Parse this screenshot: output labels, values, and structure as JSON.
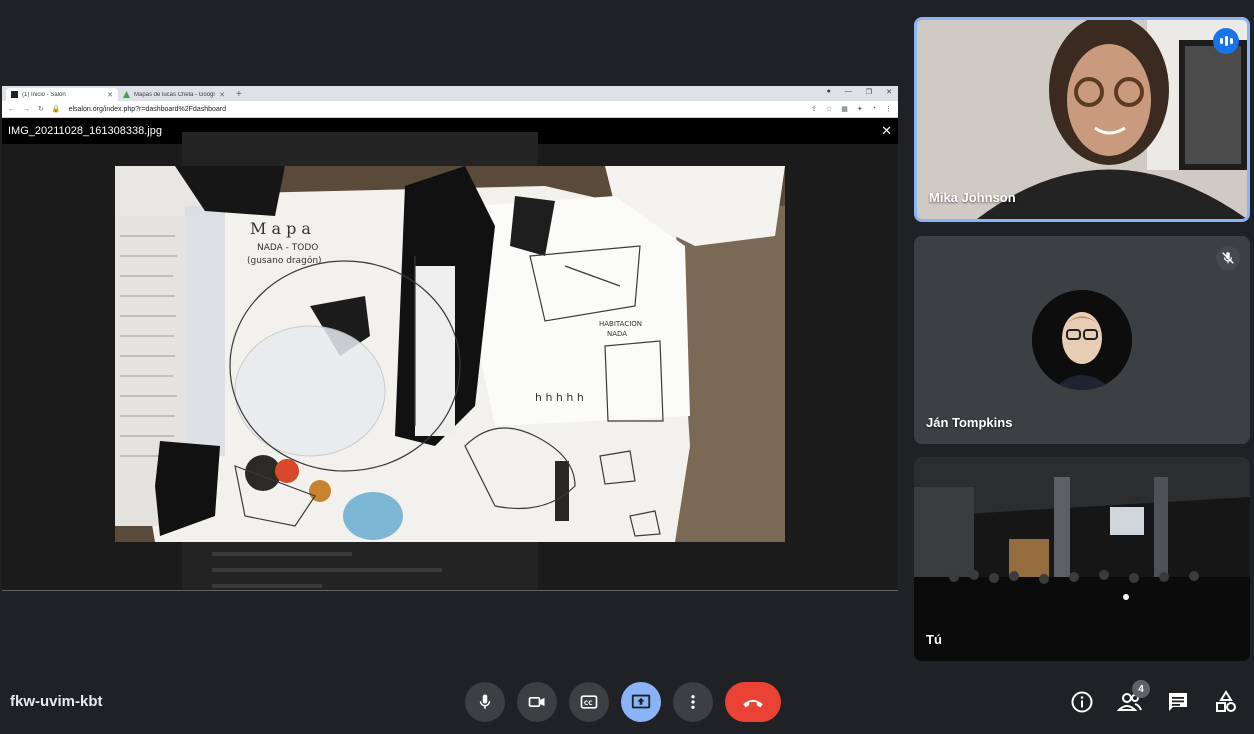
{
  "meeting": {
    "code": "fkw-uvim-kbt"
  },
  "browser": {
    "tabs": [
      {
        "label": "(1) Inicio - Salón"
      },
      {
        "label": "Mapas de lucas Chela - Google D"
      }
    ],
    "url": "elsalon.org/index.php?r=dashboard%2Fdashboard"
  },
  "viewer": {
    "filename": "IMG_20211028_161308338.jpg"
  },
  "drawing_text": {
    "line1": "M a p a",
    "line2": "NADA - TODO",
    "line3": "(gusano dragón)",
    "hh": "h h h h h",
    "habitacion": "HABITACION",
    "nada": "NADA"
  },
  "participants": [
    {
      "name": "Mika Johnson",
      "speaking": true
    },
    {
      "name": "Ján Tompkins",
      "muted": true
    },
    {
      "name": "Tú"
    }
  ],
  "people_count": "4",
  "colors": {
    "accent": "#8ab4f8",
    "end_call": "#ea4335",
    "speaking": "#1a73e8",
    "background": "#202124"
  },
  "icons": [
    "mic-icon",
    "camera-icon",
    "captions-icon",
    "present-icon",
    "more-icon",
    "end-call-icon",
    "info-icon",
    "people-icon",
    "chat-icon",
    "activities-icon"
  ]
}
